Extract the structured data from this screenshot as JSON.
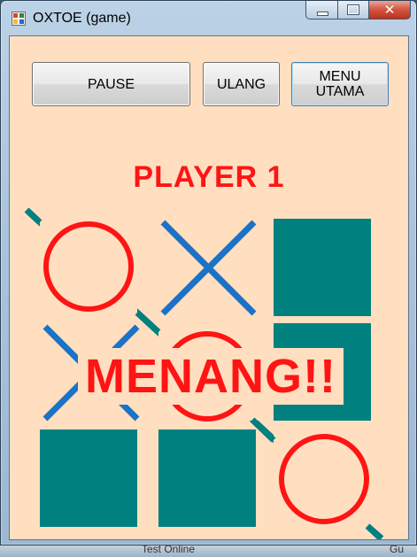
{
  "window": {
    "title": "OXTOE (game)"
  },
  "caption_buttons": {
    "minimize": "minimize",
    "maximize": "maximize",
    "close": "✕"
  },
  "toolbar": {
    "pause_label": "PAUSE",
    "ulang_label": "ULANG",
    "menu_label_line1": "MENU",
    "menu_label_line2": "UTAMA"
  },
  "status": {
    "player": "PLAYER 1",
    "result": "MENANG!!"
  },
  "board": {
    "cells": [
      "O",
      "X",
      "block",
      "X",
      "O",
      "block",
      "block",
      "block",
      "O"
    ],
    "colors": {
      "o": "#ff1414",
      "x": "#1b72c6",
      "block": "#00807f",
      "win_line": "#00807f",
      "background": "#ffdfc0"
    }
  },
  "background_app": {
    "ghost_left": "Test Online",
    "ghost_right": "Gu"
  }
}
